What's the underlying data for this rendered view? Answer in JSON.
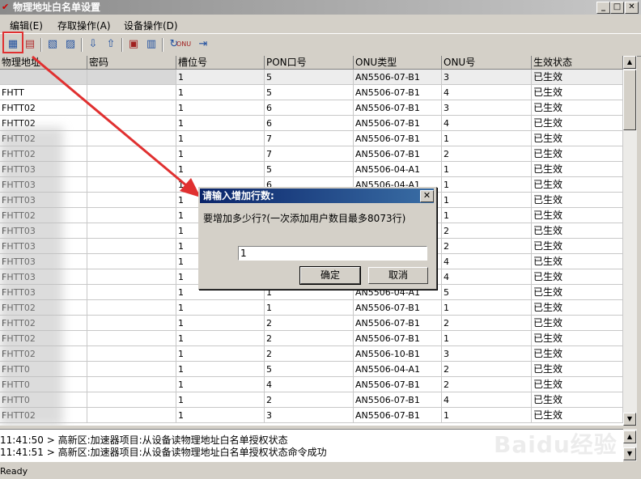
{
  "window": {
    "title": "物理地址白名单设置"
  },
  "menu": [
    "编辑(E)",
    "存取操作(A)",
    "设备操作(D)"
  ],
  "table": {
    "columns": [
      "物理地址",
      "密码",
      "槽位号",
      "PON口号",
      "ONU类型",
      "ONU号",
      "生效状态"
    ],
    "rows": [
      [
        "",
        "",
        "1",
        "5",
        "AN5506-07-B1",
        "3",
        "已生效"
      ],
      [
        "FHTT",
        "",
        "1",
        "5",
        "AN5506-07-B1",
        "4",
        "已生效"
      ],
      [
        "FHTT02",
        "",
        "1",
        "6",
        "AN5506-07-B1",
        "3",
        "已生效"
      ],
      [
        "FHTT02",
        "",
        "1",
        "6",
        "AN5506-07-B1",
        "4",
        "已生效"
      ],
      [
        "FHTT02",
        "",
        "1",
        "7",
        "AN5506-07-B1",
        "1",
        "已生效"
      ],
      [
        "FHTT02",
        "",
        "1",
        "7",
        "AN5506-07-B1",
        "2",
        "已生效"
      ],
      [
        "FHTT03",
        "",
        "1",
        "5",
        "AN5506-04-A1",
        "1",
        "已生效"
      ],
      [
        "FHTT03",
        "",
        "1",
        "6",
        "AN5506-04-A1",
        "1",
        "已生效"
      ],
      [
        "FHTT03",
        "",
        "1",
        "",
        "",
        "1",
        "已生效"
      ],
      [
        "FHTT02",
        "",
        "1",
        "",
        "",
        "1",
        "已生效"
      ],
      [
        "FHTT03",
        "",
        "1",
        "",
        "",
        "2",
        "已生效"
      ],
      [
        "FHTT03",
        "",
        "1",
        "",
        "",
        "2",
        "已生效"
      ],
      [
        "FHTT03",
        "",
        "1",
        "",
        "",
        "4",
        "已生效"
      ],
      [
        "FHTT03",
        "",
        "1",
        "",
        "",
        "4",
        "已生效"
      ],
      [
        "FHTT03",
        "",
        "1",
        "1",
        "AN5506-04-A1",
        "5",
        "已生效"
      ],
      [
        "FHTT02",
        "",
        "1",
        "1",
        "AN5506-07-B1",
        "1",
        "已生效"
      ],
      [
        "FHTT02",
        "",
        "1",
        "2",
        "AN5506-07-B1",
        "2",
        "已生效"
      ],
      [
        "FHTT02",
        "",
        "1",
        "2",
        "AN5506-07-B1",
        "1",
        "已生效"
      ],
      [
        "FHTT02",
        "",
        "1",
        "2",
        "AN5506-10-B1",
        "3",
        "已生效"
      ],
      [
        "FHTT0",
        "",
        "1",
        "5",
        "AN5506-04-A1",
        "2",
        "已生效"
      ],
      [
        "FHTT0",
        "",
        "1",
        "4",
        "AN5506-07-B1",
        "2",
        "已生效"
      ],
      [
        "FHTT0",
        "",
        "1",
        "2",
        "AN5506-07-B1",
        "4",
        "已生效"
      ],
      [
        "FHTT02",
        "",
        "1",
        "3",
        "AN5506-07-B1",
        "1",
        "已生效"
      ]
    ]
  },
  "log": [
    "11:41:50 > 高新区:加速器项目:从设备读物理地址白名单授权状态",
    "11:41:51 > 高新区:加速器项目:从设备读物理地址白名单授权状态命令成功"
  ],
  "status": "Ready",
  "dialog": {
    "title": "请输入增加行数:",
    "message": "要增加多少行?(一次添加用户数目最多8073行)",
    "input_value": "1",
    "ok_label": "确定",
    "cancel_label": "取消"
  },
  "watermark": "Baidu经验",
  "colors": {
    "arrow": "#e03030",
    "dialog_title": "#0a246a"
  }
}
